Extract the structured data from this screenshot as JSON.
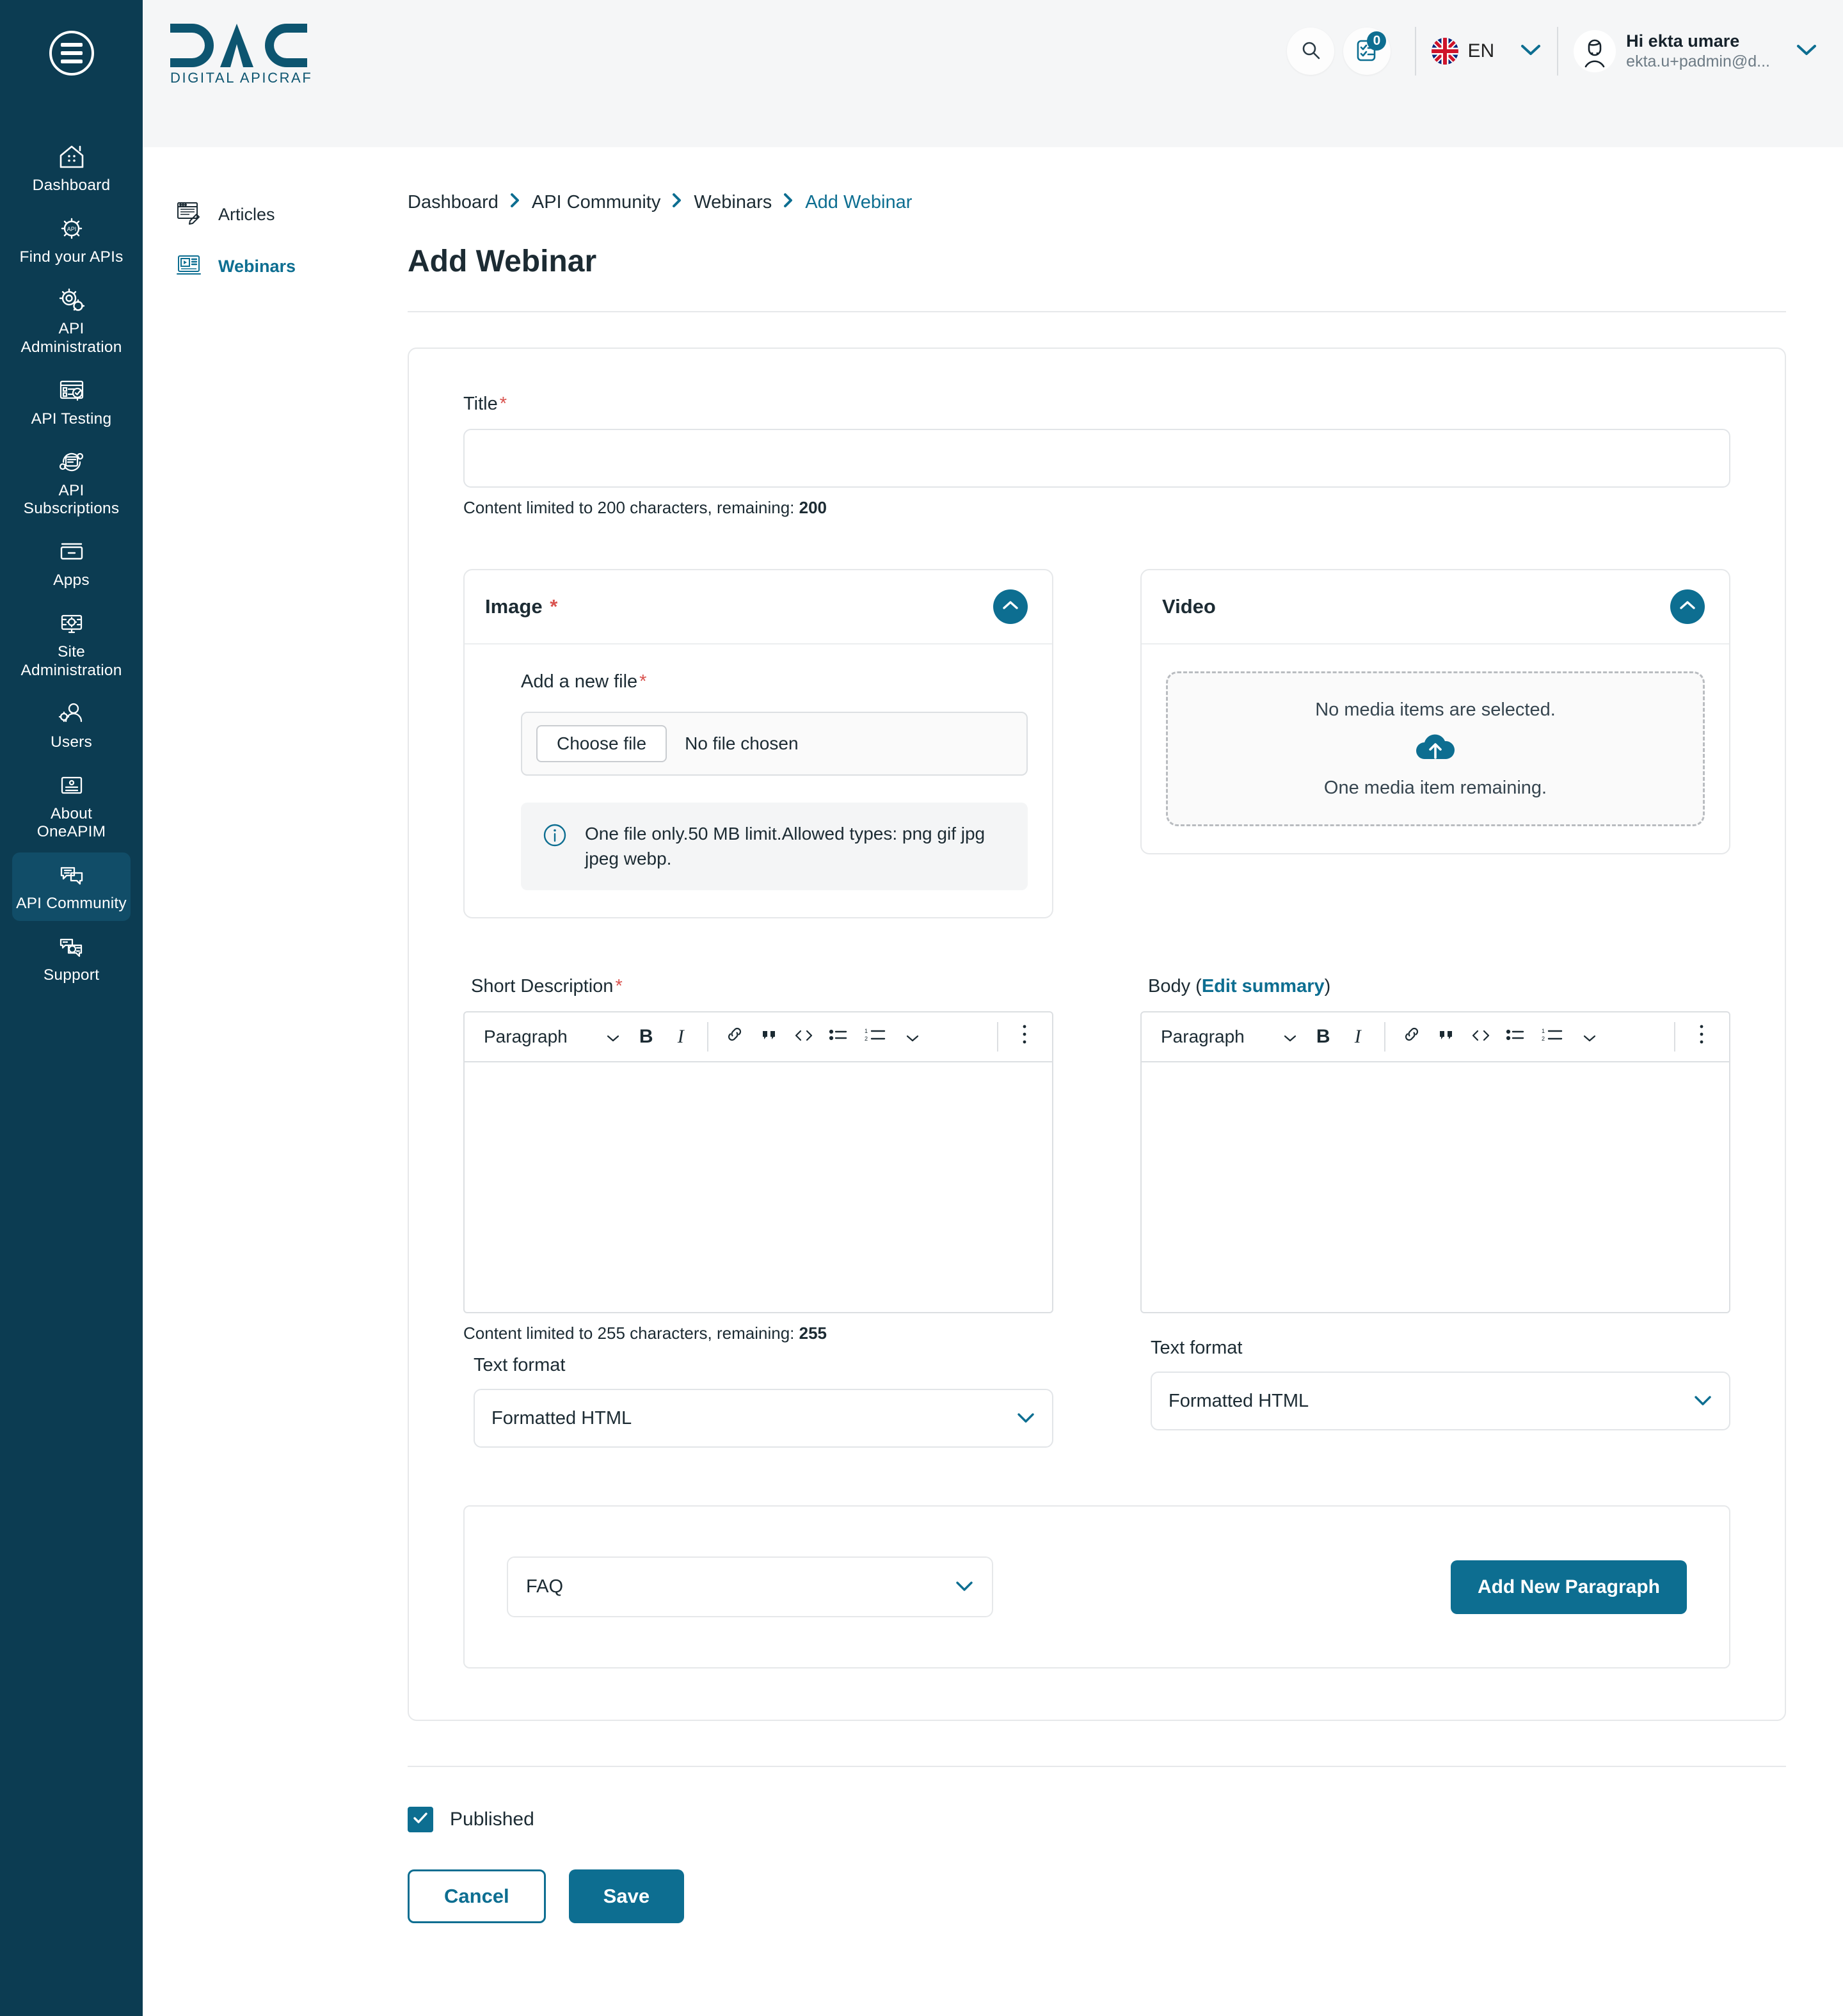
{
  "brand": {
    "logo_text": "DAC",
    "logo_sub": "DIGITAL APICRAFT",
    "accent": "#0d6e91",
    "sidebar_bg": "#0c3c52"
  },
  "sidebar": {
    "menu_icon": "hamburger-icon",
    "items": [
      {
        "label": "Dashboard",
        "icon": "home-dashboard-icon",
        "active": false
      },
      {
        "label": "Find your APIs",
        "icon": "api-gear-icon",
        "active": false
      },
      {
        "label": "API\nAdministration",
        "icon": "gears-check-icon",
        "active": false
      },
      {
        "label": "API Testing",
        "icon": "test-checklist-icon",
        "active": false
      },
      {
        "label": "API\nSubscriptions",
        "icon": "subscription-cycle-icon",
        "active": false
      },
      {
        "label": "Apps",
        "icon": "apps-drawer-icon",
        "active": false
      },
      {
        "label": "Site\nAdministration",
        "icon": "monitor-gear-icon",
        "active": false
      },
      {
        "label": "Users",
        "icon": "user-gear-icon",
        "active": false
      },
      {
        "label": "About OneAPIM",
        "icon": "info-document-icon",
        "active": false
      },
      {
        "label": "API Community",
        "icon": "chat-bubbles-icon",
        "active": true
      },
      {
        "label": "Support",
        "icon": "support-headset-icon",
        "active": false
      }
    ]
  },
  "topbar": {
    "search_icon": "search-icon",
    "notifications_icon": "checklist-notification-icon",
    "notifications_count": "0",
    "language": {
      "code": "EN",
      "flag": "uk-flag-icon",
      "chevron": "chevron-down-icon"
    },
    "user": {
      "greeting": "Hi ekta umare",
      "email": "ekta.u+padmin@d...",
      "avatar": "user-avatar-icon",
      "chevron": "chevron-down-icon"
    }
  },
  "subnav": {
    "items": [
      {
        "label": "Articles",
        "icon": "article-edit-icon",
        "active": false
      },
      {
        "label": "Webinars",
        "icon": "webinar-screen-icon",
        "active": true
      }
    ]
  },
  "breadcrumb": {
    "items": [
      "Dashboard",
      "API Community",
      "Webinars",
      "Add Webinar"
    ],
    "separator": "›"
  },
  "page": {
    "title": "Add Webinar"
  },
  "form": {
    "title_field": {
      "label": "Title",
      "required": "*",
      "value": "",
      "placeholder": "",
      "helper_prefix": "Content limited to 200 characters, remaining: ",
      "helper_count": "200"
    },
    "image_panel": {
      "title": "Image",
      "required": "*",
      "collapse_icon": "chevron-up-icon",
      "add_file_label": "Add a new file",
      "add_file_required": "*",
      "choose_button": "Choose file",
      "no_file_text": "No file chosen",
      "info_icon": "info-circle-icon",
      "info_text": "One file only.50 MB limit.Allowed types: png gif jpg jpeg webp."
    },
    "video_panel": {
      "title": "Video",
      "collapse_icon": "chevron-up-icon",
      "empty_text": "No media items are selected.",
      "upload_icon": "cloud-upload-icon",
      "remaining_text": "One media item remaining."
    },
    "short_description": {
      "label": "Short Description",
      "required": "*",
      "toolbar": {
        "paragraph_label": "Paragraph",
        "paragraph_chevron": "chevron-down-icon",
        "bold": "B",
        "italic": "I",
        "link_icon": "link-icon",
        "quote_icon": "blockquote-icon",
        "code_icon": "code-icon",
        "bullet_list_icon": "bulleted-list-icon",
        "numbered_list_icon": "numbered-list-icon",
        "list_chevron": "chevron-down-icon",
        "overflow_icon": "kebab-menu-icon"
      },
      "value": "",
      "helper_prefix": "Content limited to 255 characters, remaining: ",
      "helper_count": "255",
      "text_format_label": "Text format",
      "text_format_value": "Formatted HTML",
      "text_format_chevron": "chevron-down-icon"
    },
    "body": {
      "label_prefix": "Body (",
      "label_link": "Edit summary",
      "label_suffix": ")",
      "toolbar": {
        "paragraph_label": "Paragraph",
        "paragraph_chevron": "chevron-down-icon",
        "bold": "B",
        "italic": "I",
        "link_icon": "link-icon",
        "quote_icon": "blockquote-icon",
        "code_icon": "code-icon",
        "bullet_list_icon": "bulleted-list-icon",
        "numbered_list_icon": "numbered-list-icon",
        "list_chevron": "chevron-down-icon",
        "overflow_icon": "kebab-menu-icon"
      },
      "value": "",
      "text_format_label": "Text format",
      "text_format_value": "Formatted HTML",
      "text_format_chevron": "chevron-down-icon"
    },
    "paragraph_adder": {
      "select_value": "FAQ",
      "select_chevron": "chevron-down-icon",
      "add_button": "Add New Paragraph"
    }
  },
  "footer": {
    "published_label": "Published",
    "published_checked": true,
    "check_icon": "check-icon",
    "cancel_button": "Cancel",
    "save_button": "Save"
  }
}
